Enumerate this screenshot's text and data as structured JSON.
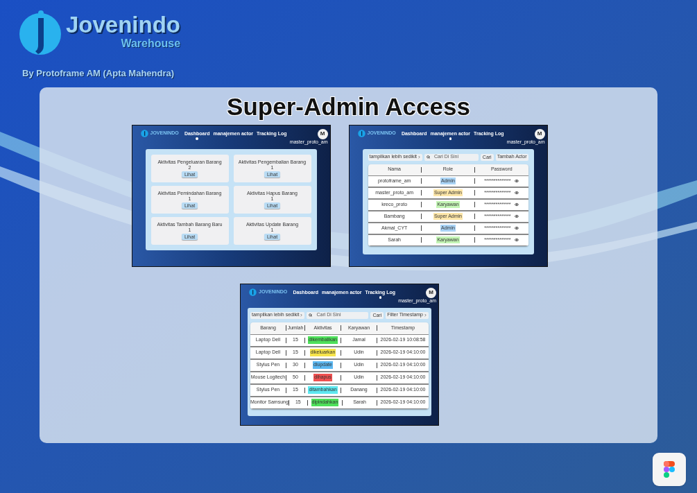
{
  "brand": {
    "name": "Jovenindo",
    "subtitle": "Warehouse",
    "byline": "By Protoframe AM (Apta Mahendra)"
  },
  "title": "Super-Admin Access",
  "screens": [
    {
      "kind": "dashboard",
      "brand": "JOVENINDO",
      "avatar": "M",
      "username": "master_proto_am",
      "nav": [
        {
          "label": "Dashboard",
          "selected": true
        },
        {
          "label": "manajemen actor",
          "selected": false
        },
        {
          "label": "Tracking Log",
          "selected": false
        }
      ],
      "cards": [
        {
          "title": "Aktivitas Pengeluaran Barang",
          "count": "2",
          "button": "Lihat"
        },
        {
          "title": "Aktivitas Pengembalian Barang",
          "count": "1",
          "button": "Lihat"
        },
        {
          "title": "Aktivitas Pemindahan Barang",
          "count": "1",
          "button": "Lihat"
        },
        {
          "title": "Aktivitas Hapus Barang",
          "count": "1",
          "button": "Lihat"
        },
        {
          "title": "Aktivitas Tambah Barang Baru",
          "count": "1",
          "button": "Lihat"
        },
        {
          "title": "Aktivitas Update Barang",
          "count": "1",
          "button": "Lihat"
        }
      ]
    },
    {
      "kind": "actors",
      "brand": "JOVENINDO",
      "avatar": "M",
      "username": "master_proto_am",
      "nav": [
        {
          "label": "Dashboard",
          "selected": false
        },
        {
          "label": "manajemen actor",
          "selected": true
        },
        {
          "label": "Tracking Log",
          "selected": false
        }
      ],
      "toolbar": {
        "toggle": "tampilkan lebih sedikit",
        "search_placeholder": "Cari Di Sini",
        "search_button": "Cari",
        "extra_button": "Tambah Actor"
      },
      "columns": [
        "Nama",
        "Role",
        "Password"
      ],
      "rows": [
        {
          "name": "protoframe_am",
          "role": "Admin",
          "color": "#a9d3f5",
          "password": "**************"
        },
        {
          "name": "master_proto_am",
          "role": "Super Admin",
          "color": "#fde6a8",
          "password": "**************"
        },
        {
          "name": "kreco_proto",
          "role": "Karyawan",
          "color": "#c4f5b5",
          "password": "**************"
        },
        {
          "name": "Bambang",
          "role": "Super Admin",
          "color": "#fde6a8",
          "password": "**************"
        },
        {
          "name": "Akmal_CYT",
          "role": "Admin",
          "color": "#a9d3f5",
          "password": "**************"
        },
        {
          "name": "Sarah",
          "role": "Karyawan",
          "color": "#c4f5b5",
          "password": "**************"
        }
      ]
    },
    {
      "kind": "log",
      "brand": "JOVENINDO",
      "avatar": "M",
      "username": "master_proto_am",
      "nav": [
        {
          "label": "Dashboard",
          "selected": false
        },
        {
          "label": "manajemen actor",
          "selected": false
        },
        {
          "label": "Tracking Log",
          "selected": true
        }
      ],
      "toolbar": {
        "toggle": "tampilkan lebih sedikit",
        "search_placeholder": "Cari Di Sini",
        "search_button": "Cari",
        "extra_button": "Filter Timestamp"
      },
      "columns": [
        "Barang",
        "Jumlah",
        "Aktivitas",
        "Karyawan",
        "Timestamp"
      ],
      "rows": [
        {
          "cells": [
            "Laptop Dell",
            "15",
            "dikembalikan",
            "Jamal",
            "2026-02-19 10:08:58"
          ],
          "color": "#4ee05a"
        },
        {
          "cells": [
            "Laptop Dell",
            "15",
            "dikeluarkan",
            "Udin",
            "2026-02-19 04:10:00"
          ],
          "color": "#f7e44a"
        },
        {
          "cells": [
            "Stylus Pen",
            "30",
            "diupdate",
            "Udin",
            "2026-02-19 04:10:00"
          ],
          "color": "#5cb8f2"
        },
        {
          "cells": [
            "Mouse Logitech",
            "50",
            "dihapus",
            "Udin",
            "2026-02-19 04:10:00"
          ],
          "color": "#f05050"
        },
        {
          "cells": [
            "Stylus Pen",
            "15",
            "ditambahkan",
            "Danang",
            "2026-02-19 04:10:00"
          ],
          "color": "#5ee8f0"
        },
        {
          "cells": [
            "Monitor Samsung",
            "15",
            "dipindahkan",
            "Sarah",
            "2026-02-19 04:10:00"
          ],
          "color": "#4ee05a"
        }
      ]
    }
  ]
}
